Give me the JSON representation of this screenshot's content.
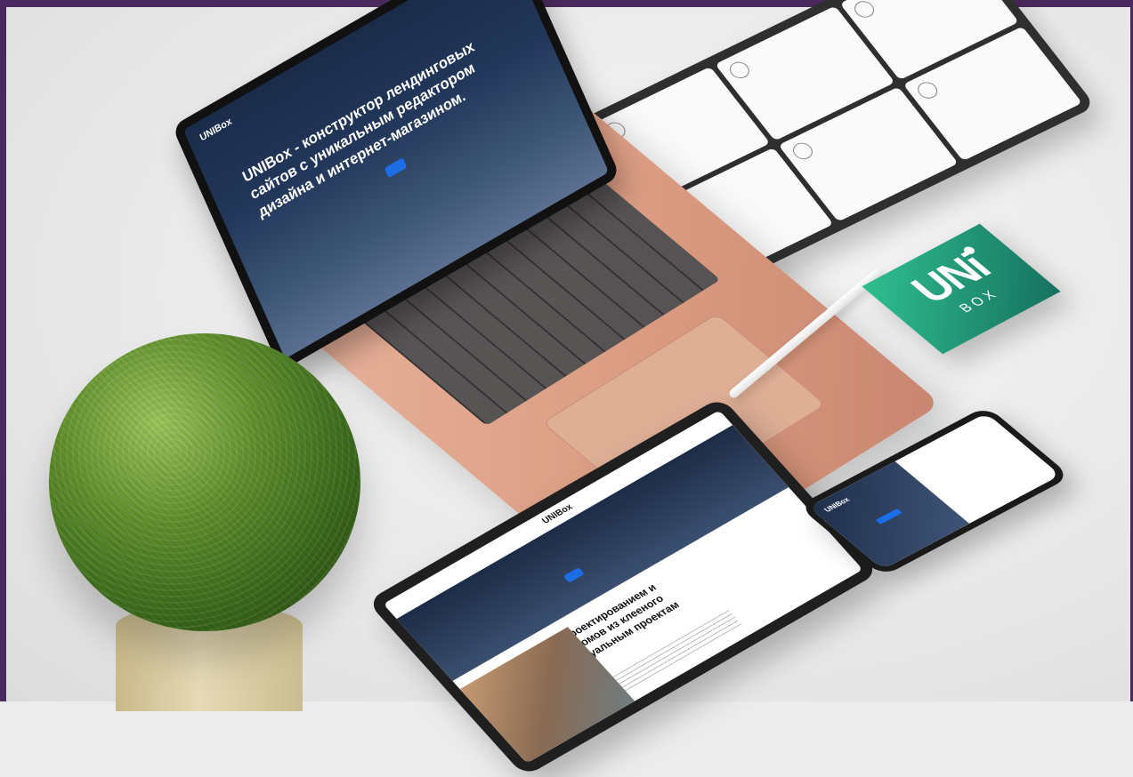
{
  "laptop_screen": {
    "logo": "UNIBox",
    "nav": "",
    "headline": "UNIBox - конструктор лендинговых сайтов с уникальным редактором дизайна и интернет-магазином.",
    "cta": "",
    "stats": [
      "",
      "",
      "",
      ""
    ]
  },
  "tablet_top": {
    "tiles": [
      {
        "title": "",
        "sub": ""
      },
      {
        "title": "",
        "sub": ""
      },
      {
        "title": "",
        "sub": ""
      },
      {
        "title": "",
        "sub": ""
      },
      {
        "title": "",
        "sub": ""
      },
      {
        "title": "",
        "sub": ""
      }
    ]
  },
  "logo_card": {
    "main": "UNi",
    "sub": "BOX",
    "colors": {
      "start": "#2fbf8f",
      "end": "#16705f"
    }
  },
  "tablet_bottom": {
    "logo": "UNIBox",
    "hero_text": "",
    "cta": "",
    "heading": "Мы занимаемся проектированием и строительством домов из клееного бруса по индивидуальным проектам"
  },
  "phone": {
    "logo": "UNIBox",
    "text": ""
  }
}
